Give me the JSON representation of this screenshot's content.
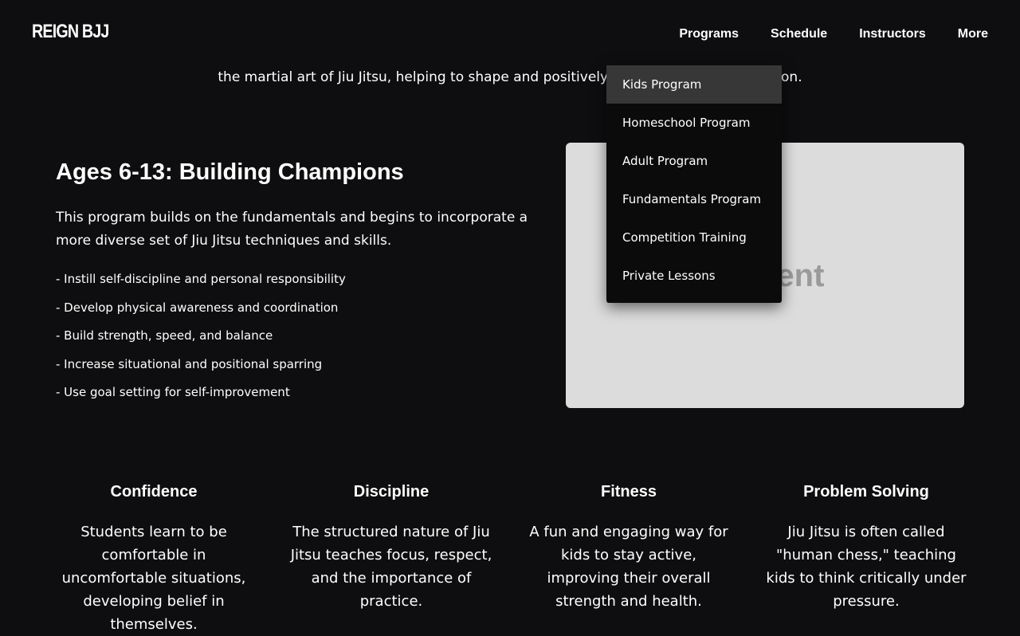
{
  "header": {
    "logo": "REIGN BJJ",
    "nav": [
      "Programs",
      "Schedule",
      "Instructors",
      "More"
    ]
  },
  "intro_text": "the martial art of Jiu Jitsu, helping to shape and positively impact the next generation.",
  "dropdown": {
    "items": [
      "Kids Program",
      "Homeschool Program",
      "Adult Program",
      "Fundamentals Program",
      "Competition Training",
      "Private Lessons"
    ],
    "active_index": 0
  },
  "section": {
    "title": "Ages 6-13: Building Champions",
    "lead": "This program builds on the fundamentals and begins to incorporate a more diverse set of Jiu Jitsu techniques and skills.",
    "bullets": [
      "- Instill self-discipline and personal responsibility",
      "- Develop physical awareness and coordination",
      "- Build strength, speed, and balance",
      "- Increase situational and positional sparring",
      "- Use goal setting for self-improvement"
    ],
    "image_placeholder": "Student"
  },
  "features": [
    {
      "title": "Confidence",
      "text": "Students learn to be comfortable in uncomfortable situations, developing belief in themselves."
    },
    {
      "title": "Discipline",
      "text": "The structured nature of Jiu Jitsu teaches focus, respect, and the importance of practice."
    },
    {
      "title": "Fitness",
      "text": "A fun and engaging way for kids to stay active, improving their overall strength and health."
    },
    {
      "title": "Problem Solving",
      "text": "Jiu Jitsu is often called \"human chess,\" teaching kids to think critically under pressure."
    }
  ],
  "colors": {
    "background": "#0e0e10",
    "dropdown_active": "#373737",
    "image_bg": "#dcdcdc"
  }
}
